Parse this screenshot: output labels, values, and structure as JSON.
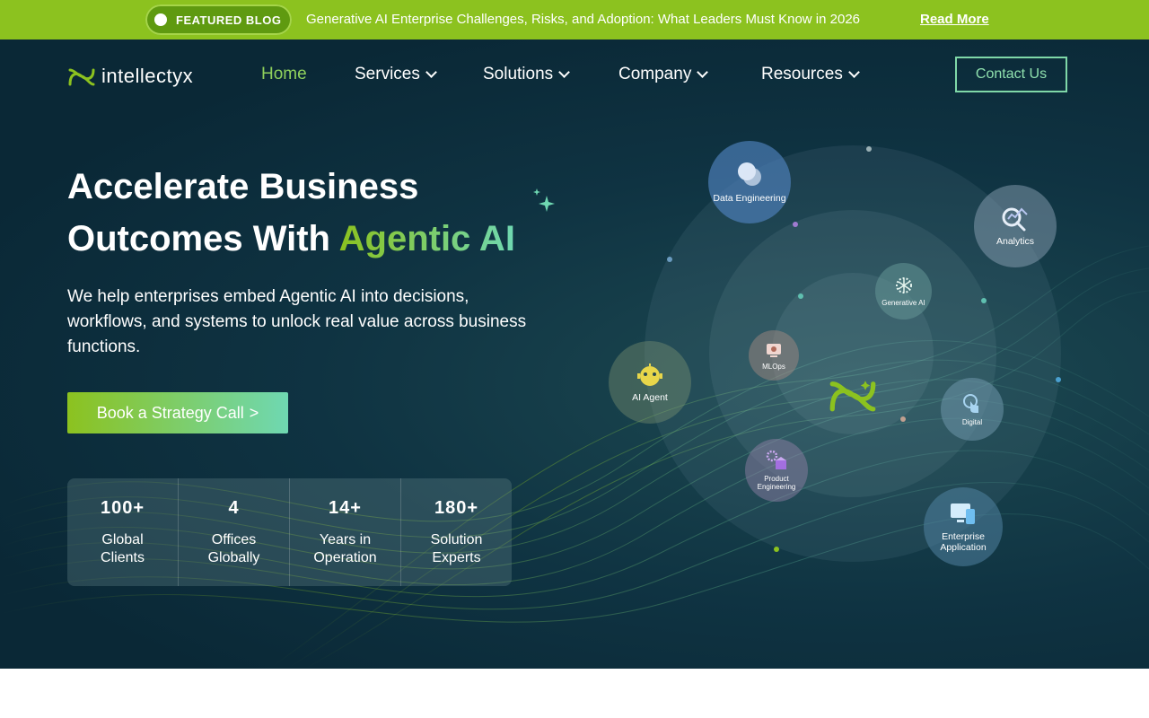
{
  "topbar": {
    "badge": "FEATURED BLOG",
    "headline": "Generative AI Enterprise Challenges, Risks, and Adoption: What Leaders Must Know in 2026",
    "read_more": "Read More"
  },
  "header": {
    "brand": "intellectyx",
    "nav": [
      "Home",
      "Services",
      "Solutions",
      "Company",
      "Resources"
    ],
    "contact": "Contact Us"
  },
  "hero": {
    "title_line1": "Accelerate Business",
    "title_line2_plain": "Outcomes With ",
    "title_line2_accent": "Agentic AI",
    "subtitle": "We help enterprises embed Agentic AI into decisions, workflows, and systems to unlock real value across business functions.",
    "cta": "Book a Strategy Call",
    "cta_arrow": ">"
  },
  "stats": [
    {
      "num": "100+",
      "label": "Global Clients"
    },
    {
      "num": "4",
      "label": "Offices Globally"
    },
    {
      "num": "14+",
      "label": "Years in Operation"
    },
    {
      "num": "180+",
      "label": "Solution Experts"
    }
  ],
  "orbit": {
    "data_engineering": "Data Engineering",
    "analytics": "Analytics",
    "generative_ai": "Generative AI",
    "ai_agent": "AI Agent",
    "mlops": "MLOps",
    "digital": "Digital",
    "product_engineering": "Product Engineering",
    "enterprise_application": "Enterprise Application"
  },
  "colors": {
    "brand_green": "#8cc21f",
    "accent_teal": "#6fd8b2",
    "hero_bg": "#0f3342"
  }
}
